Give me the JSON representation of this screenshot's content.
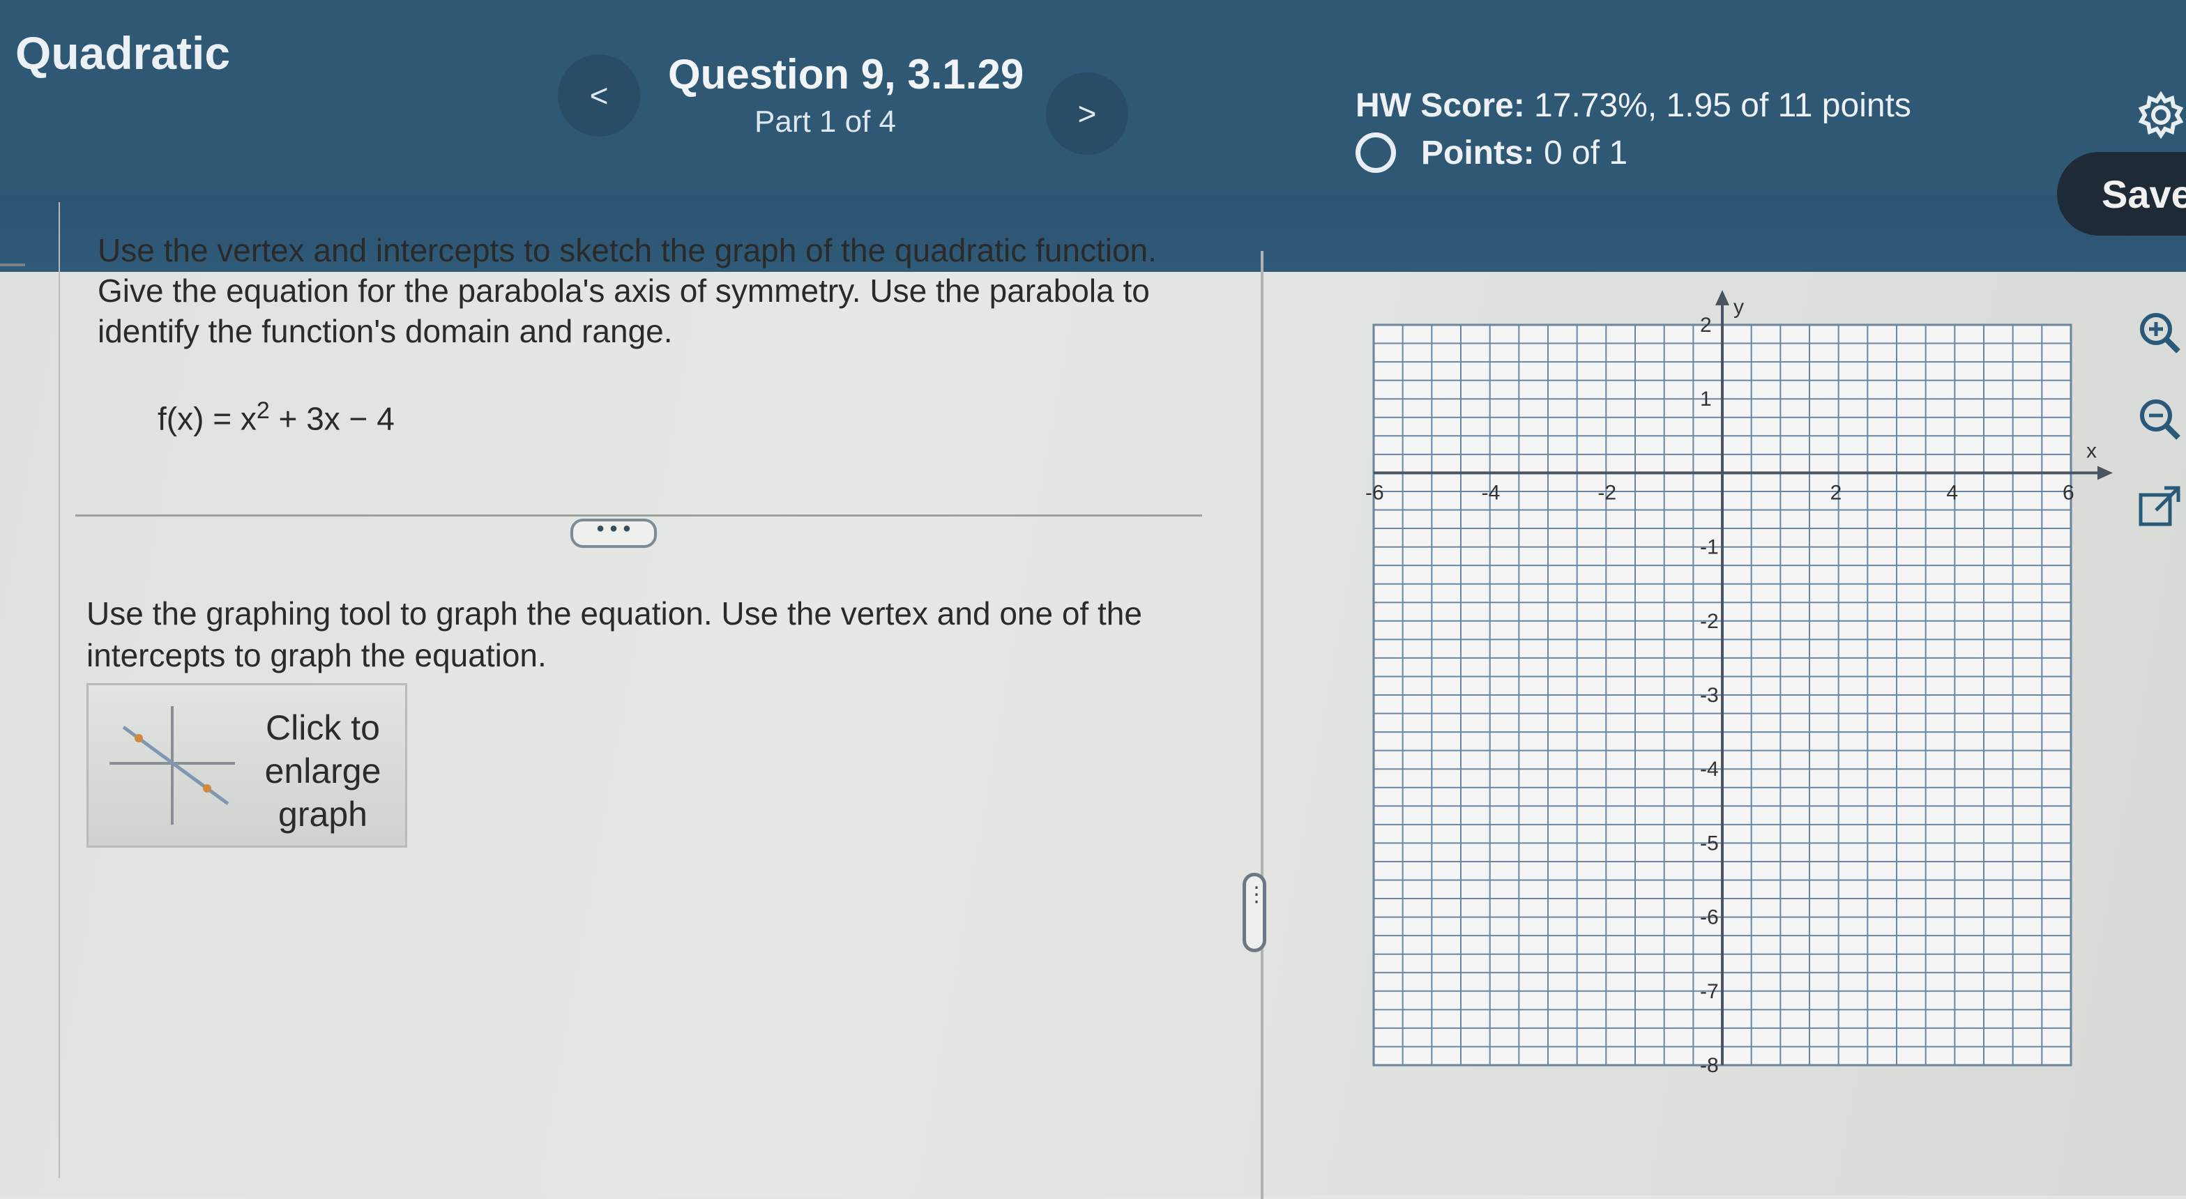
{
  "header": {
    "app_title": "Quadratic",
    "question_title": "Question 9, 3.1.29",
    "question_part": "Part 1 of 4",
    "prev_label": "<",
    "next_label": ">",
    "hw_score_label": "HW Score:",
    "hw_score_value": "17.73%, 1.95 of 11 points",
    "points_label": "Points:",
    "points_value": "0 of 1",
    "save_label": "Save"
  },
  "problem": {
    "prompt": "Use the vertex and intercepts to sketch the graph of the quadratic function. Give the equation for the parabola's axis of symmetry.  Use the parabola to identify the function's domain and range.",
    "equation_left": "f(x) = x",
    "equation_exponent": "2",
    "equation_right": " + 3x − 4",
    "expand_label": "• • •",
    "instruction": "Use the graphing tool to graph the equation.  Use the vertex and one of the intercepts to graph the equation.",
    "enlarge_label": "Click to enlarge graph"
  },
  "graph": {
    "x_axis_label": "x",
    "y_axis_label": "y",
    "x_range": [
      -6,
      6
    ],
    "y_range": [
      -8,
      2
    ],
    "x_tick_labels": [
      "-6",
      "-4",
      "-2",
      "2",
      "4",
      "6"
    ],
    "y_tick_labels": [
      "2",
      "1",
      "-1",
      "-2",
      "-3",
      "-4",
      "-5",
      "-6",
      "-7",
      "-8"
    ]
  },
  "tools": {
    "zoom_in_icon": "zoom-in-icon",
    "zoom_out_icon": "zoom-out-icon",
    "popout_icon": "popout-icon"
  },
  "colors": {
    "header_bg": "#2f5875",
    "save_bg": "#1e2b36",
    "tool_accent": "#2a5a7a"
  }
}
